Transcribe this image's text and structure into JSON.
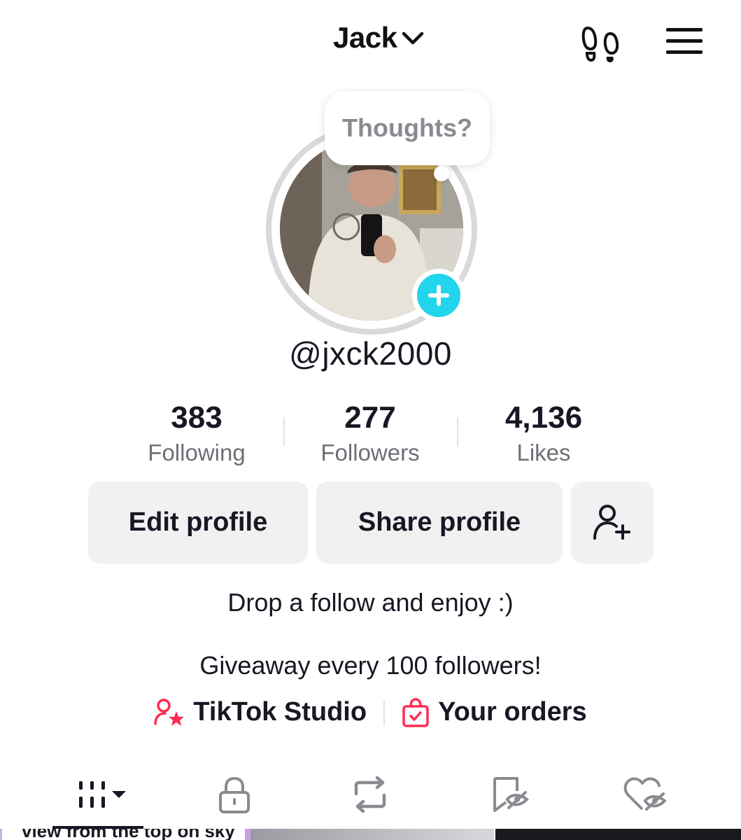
{
  "header": {
    "title": "Jack",
    "icons": [
      "chevron-down-icon",
      "footprint-icon",
      "menu-icon"
    ]
  },
  "avatar": {
    "bubble_text": "Thoughts?",
    "plus_icon": "plus-icon",
    "accent_color": "#20d5ec"
  },
  "profile": {
    "username": "@jxck2000"
  },
  "stats": [
    {
      "value": "383",
      "label": "Following"
    },
    {
      "value": "277",
      "label": "Followers"
    },
    {
      "value": "4,136",
      "label": "Likes"
    }
  ],
  "actions": {
    "edit_label": "Edit profile",
    "share_label": "Share profile",
    "add_friend_icon": "add-user-icon"
  },
  "bio": {
    "line1": "Drop a follow and enjoy :)",
    "line2": "Giveaway every 100 followers!"
  },
  "links": {
    "studio_label": "TikTok Studio",
    "orders_label": "Your orders",
    "accent_color": "#fe2c55"
  },
  "tabs": [
    "videos-grid-icon",
    "lock-icon",
    "repost-icon",
    "favorites-icon",
    "liked-icon"
  ],
  "thumbnail": {
    "caption": "view from the top on sky"
  }
}
